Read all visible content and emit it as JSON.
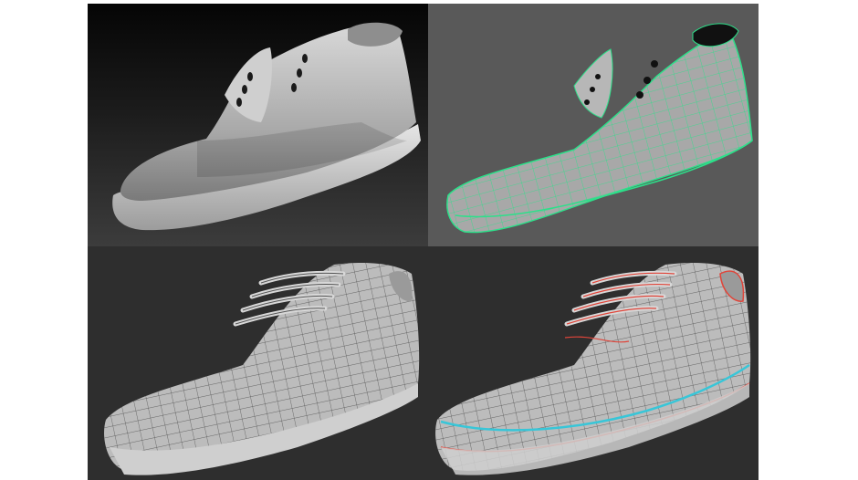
{
  "panels": [
    {
      "id": "sculpt",
      "description_icon": "shoe-sculpt-render",
      "style": "smooth-shaded"
    },
    {
      "id": "retopo",
      "description_icon": "shoe-wireframe-green",
      "wire_color": "#2de08a"
    },
    {
      "id": "lowpoly",
      "description_icon": "shoe-lowpoly-laces",
      "wire_color": "#3a3a3a"
    },
    {
      "id": "seams",
      "description_icon": "shoe-uv-seams",
      "seam_colors": [
        "#e0453a",
        "#38c6d8"
      ]
    }
  ],
  "colors": {
    "background": "#ffffff",
    "shoe_gray": "#bdbdbd",
    "wire_green": "#2de08a",
    "seam_red": "#e0453a",
    "seam_cyan": "#38c6d8"
  }
}
